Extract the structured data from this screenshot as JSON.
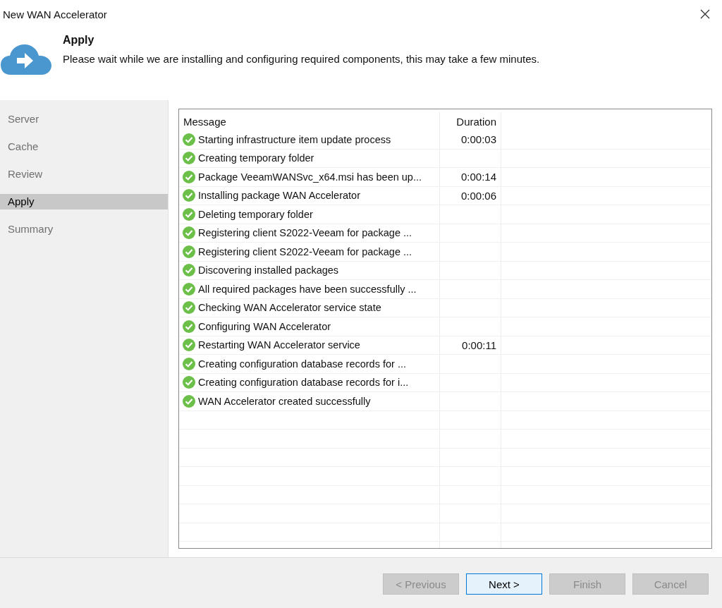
{
  "window": {
    "title": "New WAN Accelerator"
  },
  "header": {
    "title": "Apply",
    "description": "Please wait while we are installing and configuring required components, this may take a few minutes."
  },
  "steps": [
    {
      "label": "Server",
      "selected": false
    },
    {
      "label": "Cache",
      "selected": false
    },
    {
      "label": "Review",
      "selected": false
    },
    {
      "label": "Apply",
      "selected": true
    },
    {
      "label": "Summary",
      "selected": false
    }
  ],
  "table": {
    "columns": [
      "Message",
      "Duration"
    ],
    "rows": [
      {
        "kind": "success",
        "message": "Starting infrastructure item update process",
        "duration": "0:00:03"
      },
      {
        "kind": "success",
        "message": "Creating temporary folder",
        "duration": ""
      },
      {
        "kind": "success",
        "message": "Package VeeamWANSvc_x64.msi has been up...",
        "duration": "0:00:14"
      },
      {
        "kind": "success",
        "message": "Installing package WAN Accelerator",
        "duration": "0:00:06"
      },
      {
        "kind": "success",
        "message": "Deleting temporary folder",
        "duration": ""
      },
      {
        "kind": "success",
        "message": "Registering client S2022-Veeam for package ...",
        "duration": ""
      },
      {
        "kind": "success",
        "message": "Registering client S2022-Veeam for package ...",
        "duration": ""
      },
      {
        "kind": "success",
        "message": "Discovering installed packages",
        "duration": ""
      },
      {
        "kind": "success",
        "message": "All required packages have been successfully ...",
        "duration": ""
      },
      {
        "kind": "success",
        "message": "Checking WAN Accelerator service state",
        "duration": ""
      },
      {
        "kind": "success",
        "message": "Configuring WAN Accelerator",
        "duration": ""
      },
      {
        "kind": "success",
        "message": "Restarting WAN Accelerator service",
        "duration": "0:00:11"
      },
      {
        "kind": "success",
        "message": "Creating configuration database records for ...",
        "duration": ""
      },
      {
        "kind": "success",
        "message": "Creating configuration database records for i...",
        "duration": ""
      },
      {
        "kind": "success",
        "message": "WAN Accelerator created successfully",
        "duration": ""
      }
    ]
  },
  "buttons": [
    {
      "label": "< Previous",
      "disabled": true
    },
    {
      "label": "Next >",
      "disabled": false
    },
    {
      "label": "Finish",
      "disabled": true
    },
    {
      "label": "Cancel",
      "disabled": true
    }
  ]
}
